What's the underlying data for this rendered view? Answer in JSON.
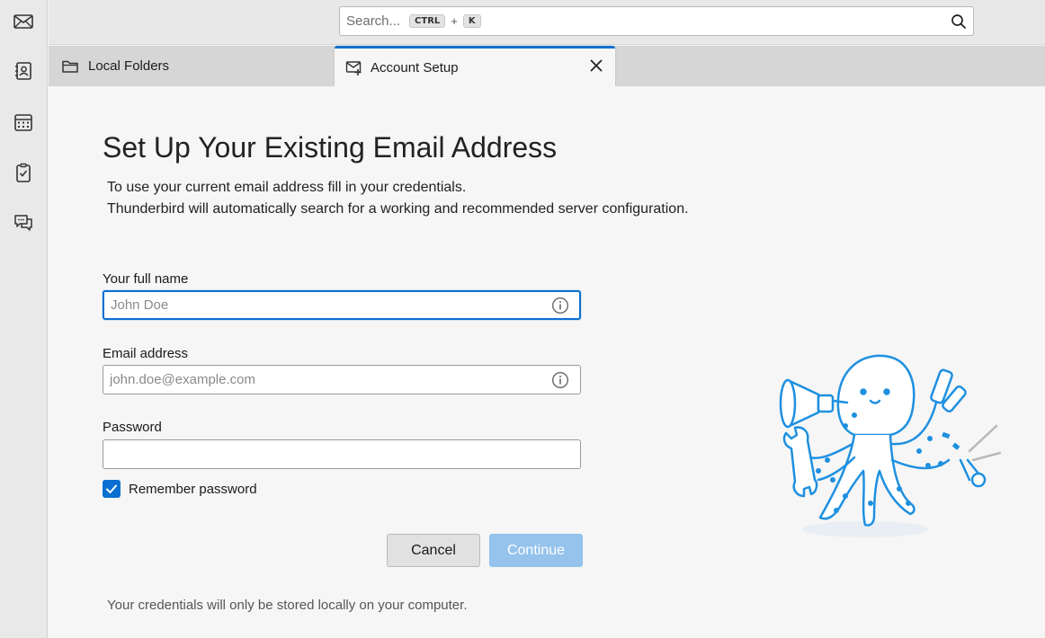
{
  "spaces": {
    "items": [
      {
        "name": "mail",
        "icon": "envelope-icon"
      },
      {
        "name": "address-book",
        "icon": "address-book-icon"
      },
      {
        "name": "calendar",
        "icon": "calendar-icon"
      },
      {
        "name": "tasks",
        "icon": "tasks-icon"
      },
      {
        "name": "chat",
        "icon": "chat-icon"
      }
    ]
  },
  "search": {
    "placeholder": "Search...",
    "shortcut_mod": "CTRL",
    "shortcut_plus": "+",
    "shortcut_key": "K",
    "icon": "search-icon"
  },
  "tabs": [
    {
      "label": "Local Folders",
      "icon": "folder-icon",
      "active": false
    },
    {
      "label": "Account Setup",
      "icon": "mail-setup-icon",
      "active": true
    }
  ],
  "setup": {
    "title": "Set Up Your Existing Email Address",
    "desc_line1": "To use your current email address fill in your credentials.",
    "desc_line2": "Thunderbird will automatically search for a working and recommended server configuration.",
    "fullname": {
      "label": "Your full name",
      "placeholder": "John Doe",
      "value": ""
    },
    "email": {
      "label": "Email address",
      "placeholder": "john.doe@example.com",
      "value": ""
    },
    "password": {
      "label": "Password",
      "value": ""
    },
    "remember": {
      "label": "Remember password",
      "checked": true
    },
    "cancel_label": "Cancel",
    "continue_label": "Continue",
    "footnote": "Your credentials will only be stored locally on your computer."
  },
  "colors": {
    "accent": "#0a6fd0",
    "continue_disabled": "#95c3ec",
    "mascot": "#1e90e0"
  }
}
